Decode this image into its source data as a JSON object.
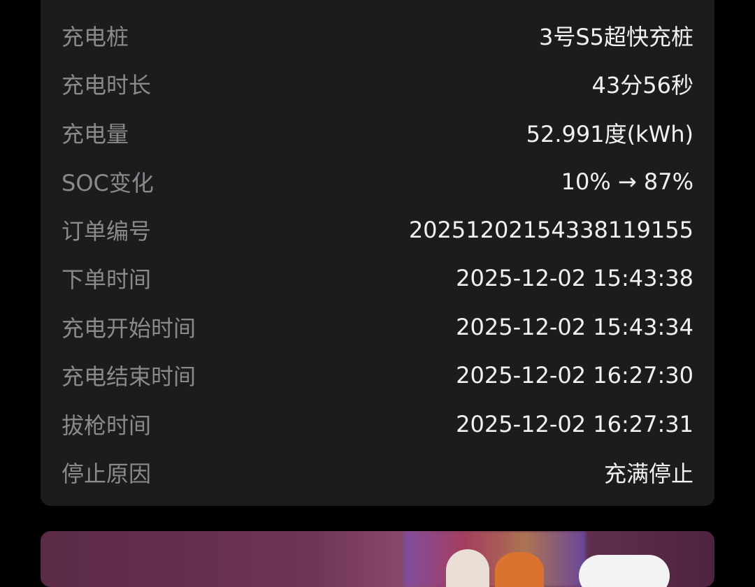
{
  "details": {
    "rows": [
      {
        "label": "充电桩",
        "value": "3号S5超快充桩"
      },
      {
        "label": "充电时长",
        "value": "43分56秒"
      },
      {
        "label": "充电量",
        "value": "52.991度(kWh)"
      },
      {
        "label": "SOC变化",
        "value": "10% → 87%"
      },
      {
        "label": "订单编号",
        "value": "20251202154338119155"
      },
      {
        "label": "下单时间",
        "value": "2025-12-02 15:43:38"
      },
      {
        "label": "充电开始时间",
        "value": "2025-12-02 15:43:34"
      },
      {
        "label": "充电结束时间",
        "value": "2025-12-02 16:27:30"
      },
      {
        "label": "拔枪时间",
        "value": "2025-12-02 16:27:31"
      },
      {
        "label": "停止原因",
        "value": "充满停止"
      }
    ]
  }
}
